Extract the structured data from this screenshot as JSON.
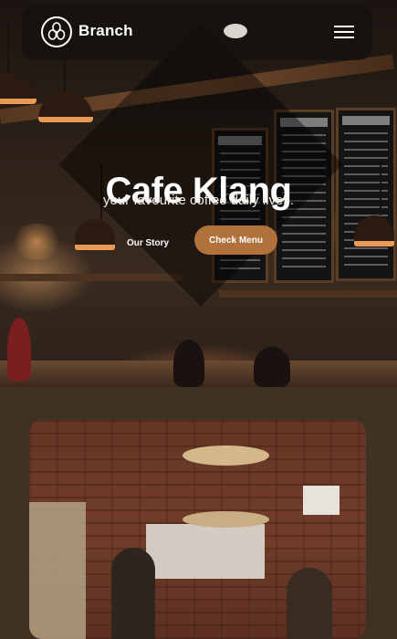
{
  "nav": {
    "brand": "Branch",
    "logo_icon": "coffee-beans-logo-icon",
    "menu_icon": "hamburger-menu-icon"
  },
  "hero": {
    "title": "Cafe Klang",
    "subtitle": "your favourite coffee daily lives.",
    "primary_cta": "Check Menu",
    "secondary_cta": "Our Story"
  },
  "colors": {
    "accent": "#b0713a",
    "section_bg": "#3f3223",
    "nav_bg": "#14100e"
  }
}
